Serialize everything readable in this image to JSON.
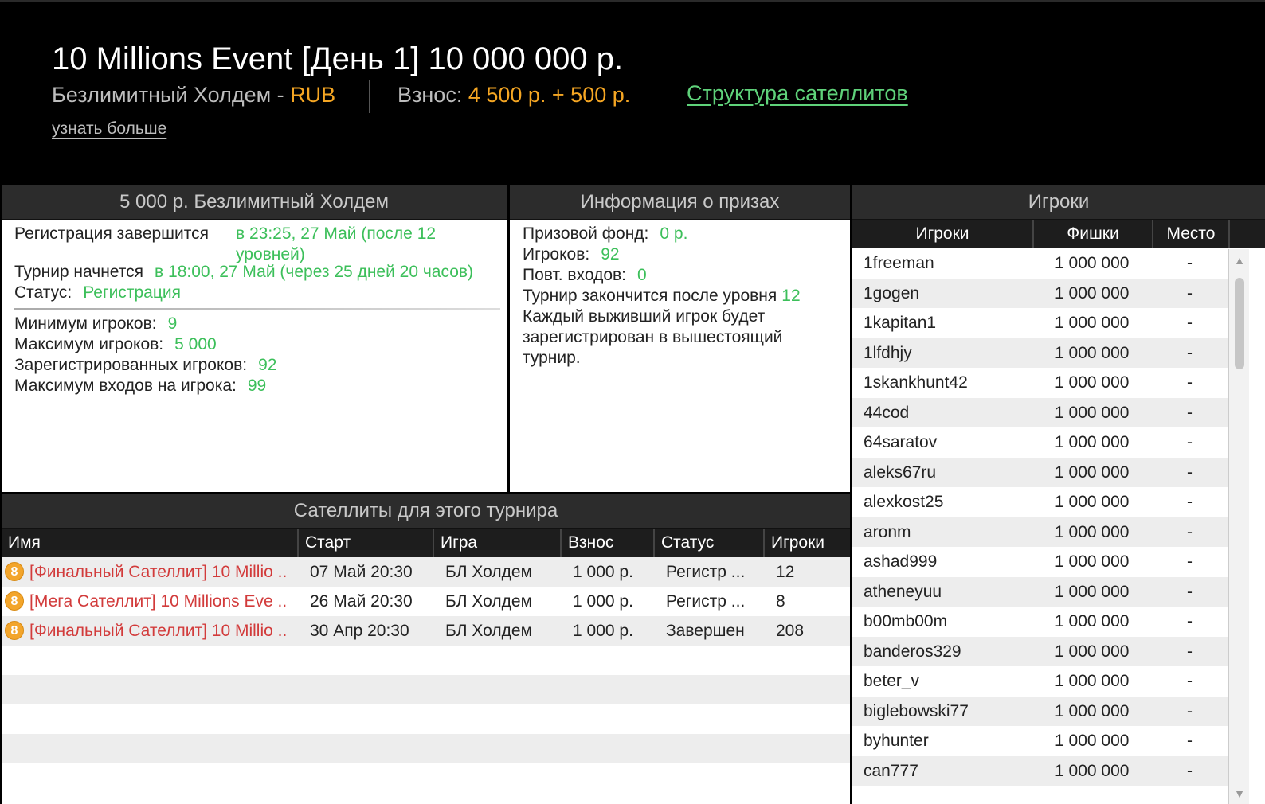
{
  "header": {
    "title": "10 Millions Event [День 1] 10 000 000 р.",
    "game_type": "Безлимитный Холдем - ",
    "currency": "RUB",
    "buyin_label": "Взнос: ",
    "buyin_amount": "4 500 р. + 500 р.",
    "satellite_structure": "Структура сателлитов",
    "learn_more": "узнать больше"
  },
  "tournament": {
    "title": "5 000 р. Безлимитный Холдем",
    "reg_ends_label": "Регистрация завершится",
    "reg_ends_value_1": "в 23:25, 27 Май (после 12",
    "reg_ends_value_2": "уровней)",
    "starts_label": "Турнир начнется",
    "starts_value": "в 18:00, 27 Май (через 25 дней 20 часов)",
    "status_label": "Статус:",
    "status_value": "Регистрация",
    "min_players_label": "Минимум игроков:",
    "min_players_value": "9",
    "max_players_label": "Максимум игроков:",
    "max_players_value": "5 000",
    "registered_label": "Зарегистрированных игроков:",
    "registered_value": "92",
    "max_entries_label": "Максимум входов на игрока:",
    "max_entries_value": "99"
  },
  "prizes": {
    "title": "Информация о призах",
    "pool_label": "Призовой фонд:",
    "pool_value": "0 р.",
    "players_label": "Игроков:",
    "players_value": "92",
    "reentries_label": "Повт. входов:",
    "reentries_value": "0",
    "ends_label": "Турнир закончится после уровня",
    "ends_value": "12",
    "note_1": "Каждый выживший игрок будет",
    "note_2": "зарегистрирован в вышестоящий",
    "note_3": "турнир."
  },
  "satellites": {
    "title": "Сателлиты для этого турнира",
    "columns": [
      "Имя",
      "Старт",
      "Игра",
      "Взнос",
      "Статус",
      "Игроки"
    ],
    "coin_glyph": "8",
    "rows": [
      {
        "name": "[Финальный Сателлит] 10 Millio ..",
        "start": "07 Май 20:30",
        "game": "БЛ Холдем",
        "buyin": "1 000 р.",
        "status": "Регистр ...",
        "players": "12"
      },
      {
        "name": "[Мега Сателлит] 10 Millions Eve ..",
        "start": "26 Май 20:30",
        "game": "БЛ Холдем",
        "buyin": "1 000 р.",
        "status": "Регистр ...",
        "players": "8"
      },
      {
        "name": "[Финальный Сателлит] 10 Millio ..",
        "start": "30 Апр 20:30",
        "game": "БЛ Холдем",
        "buyin": "1 000 р.",
        "status": "Завершен",
        "players": "208"
      }
    ]
  },
  "players": {
    "title": "Игроки",
    "columns": [
      "Игроки",
      "Фишки",
      "Место"
    ],
    "rows": [
      {
        "name": "1freeman",
        "chips": "1 000 000",
        "place": "-"
      },
      {
        "name": "1gogen",
        "chips": "1 000 000",
        "place": "-"
      },
      {
        "name": "1kapitan1",
        "chips": "1 000 000",
        "place": "-"
      },
      {
        "name": "1lfdhjy",
        "chips": "1 000 000",
        "place": "-"
      },
      {
        "name": "1skankhunt42",
        "chips": "1 000 000",
        "place": "-"
      },
      {
        "name": "44cod",
        "chips": "1 000 000",
        "place": "-"
      },
      {
        "name": "64saratov",
        "chips": "1 000 000",
        "place": "-"
      },
      {
        "name": "aleks67ru",
        "chips": "1 000 000",
        "place": "-"
      },
      {
        "name": "alexkost25",
        "chips": "1 000 000",
        "place": "-"
      },
      {
        "name": "aronm",
        "chips": "1 000 000",
        "place": "-"
      },
      {
        "name": "ashad999",
        "chips": "1 000 000",
        "place": "-"
      },
      {
        "name": "atheneyuu",
        "chips": "1 000 000",
        "place": "-"
      },
      {
        "name": "b00mb00m",
        "chips": "1 000 000",
        "place": "-"
      },
      {
        "name": "banderos329",
        "chips": "1 000 000",
        "place": "-"
      },
      {
        "name": "beter_v",
        "chips": "1 000 000",
        "place": "-"
      },
      {
        "name": "biglebowski77",
        "chips": "1 000 000",
        "place": "-"
      },
      {
        "name": "byhunter",
        "chips": "1 000 000",
        "place": "-"
      },
      {
        "name": "can777",
        "chips": "1 000 000",
        "place": "-"
      }
    ]
  },
  "scrollbar": {
    "up": "▲",
    "down": "▼"
  }
}
